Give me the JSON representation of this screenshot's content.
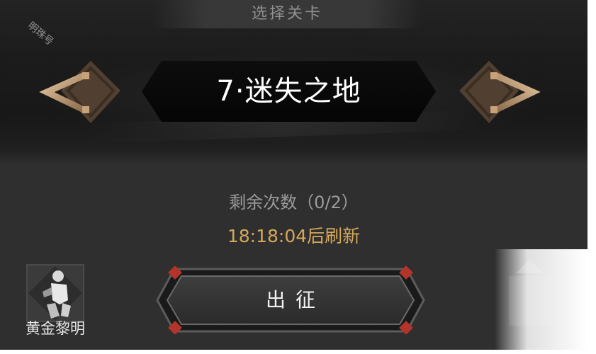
{
  "header": {
    "title": "选择关卡",
    "watermark": "明珠号"
  },
  "level": {
    "name": "7·迷失之地",
    "prev_icon": "chevron-left-icon",
    "next_icon": "chevron-right-icon"
  },
  "attempts": {
    "remaining_text": "剩余次数（0/2）",
    "remaining_used": 0,
    "remaining_total": 2,
    "refresh_text": "18:18:04后刷新"
  },
  "hero": {
    "name": "黄金黎明",
    "icon": "hero-portrait-icon"
  },
  "actions": {
    "depart_label": "出征"
  },
  "colors": {
    "background": "#2f2f2f",
    "gold_accent": "#d7a85a",
    "arrow_gold": "#c9a27a",
    "button_red_corner": "#b2342b"
  }
}
